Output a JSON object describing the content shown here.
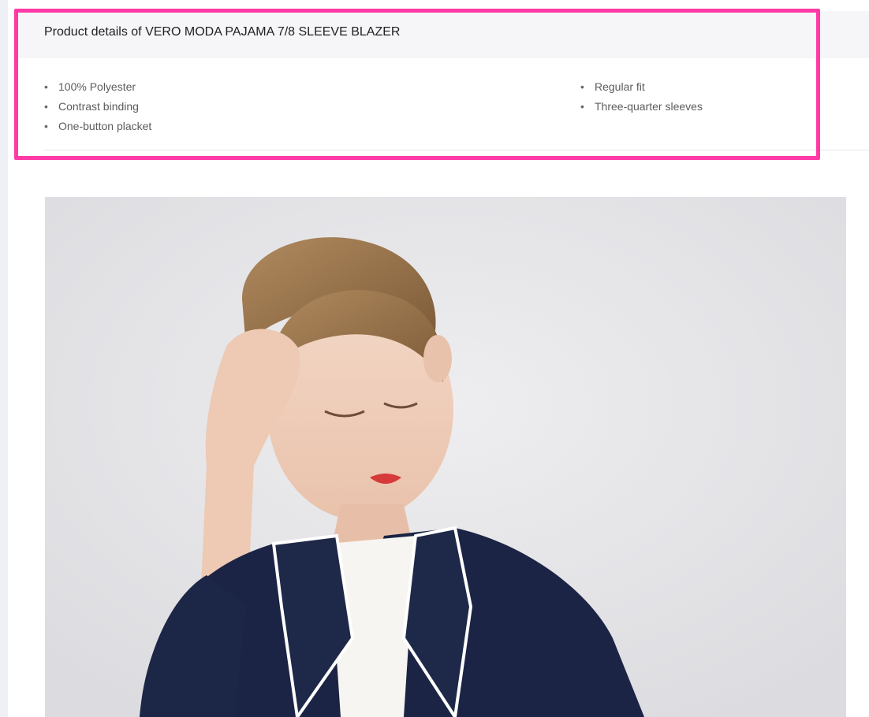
{
  "product": {
    "title": "Product details of VERO MODA PAJAMA 7/8 SLEEVE BLAZER",
    "details_left": [
      "100% Polyester",
      "Contrast binding",
      "One-button placket"
    ],
    "details_right": [
      "Regular fit",
      "Three-quarter sleeves"
    ],
    "bullet": "•"
  },
  "colors": {
    "highlight": "#ff3aa6",
    "header_bg": "#f6f6f8",
    "blazer": "#1b2444",
    "photo_bg": "#e9e9eb"
  },
  "image": {
    "subject": "product-photo-model-in-navy-blazer"
  }
}
